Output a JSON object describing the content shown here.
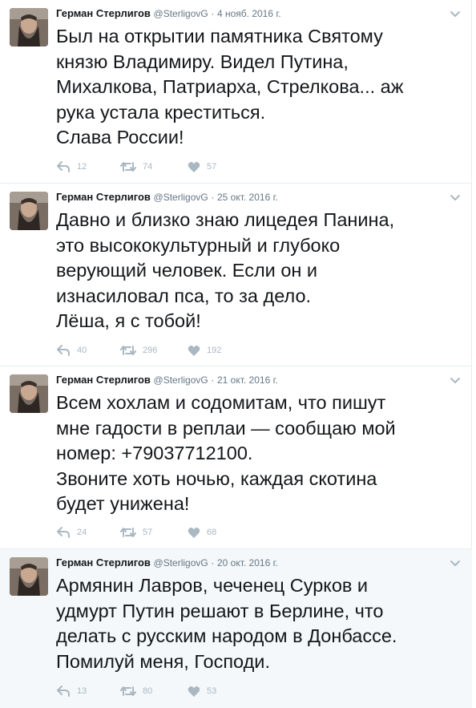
{
  "tweets": [
    {
      "name": "Герман Стерлигов",
      "handle": "@SterligovG",
      "separator": "·",
      "time": "4 нояб. 2016 г.",
      "text": "Был на открытии памятника Святому\nкнязю Владимиру. Видел Путина,\nМихалкова, Патриарха, Стрелкова... аж\nрука устала креститься.\nСлава России!",
      "replies": "12",
      "retweets": "74",
      "likes": "57"
    },
    {
      "name": "Герман Стерлигов",
      "handle": "@SterligovG",
      "separator": "·",
      "time": "25 окт. 2016 г.",
      "text": "Давно и близко знаю лицедея Панина,\nэто высококультурный и глубоко\nверующий человек. Если он и\nизнасиловал пса, то за дело.\nЛёша, я с тобой!",
      "replies": "40",
      "retweets": "296",
      "likes": "192"
    },
    {
      "name": "Герман Стерлигов",
      "handle": "@SterligovG",
      "separator": "·",
      "time": "21 окт. 2016 г.",
      "text": "Всем хохлам и содомитам, что пишут\nмне гадости в реплаи — сообщаю мой\nномер: +79037712100.\nЗвоните хоть ночью, каждая скотина\nбудет унижена!",
      "replies": "24",
      "retweets": "57",
      "likes": "68"
    },
    {
      "name": "Герман Стерлигов",
      "handle": "@SterligovG",
      "separator": "·",
      "time": "20 окт. 2016 г.",
      "text": "Армянин Лавров, чеченец Сурков и\nудмурт Путин решают в Берлине, что\nделать с русским народом в Донбассе.\nПомилуй меня, Господи.",
      "replies": "13",
      "retweets": "80",
      "likes": "53"
    }
  ],
  "colors": {
    "text": "#14171a",
    "meta": "#657786",
    "icon": "#aab8c2",
    "border": "#e6ecf0",
    "highlight_bg": "#f5f8fa"
  },
  "icons": {
    "reply": "reply-icon",
    "retweet": "retweet-icon",
    "like": "heart-icon",
    "menu": "chevron-down-icon"
  }
}
